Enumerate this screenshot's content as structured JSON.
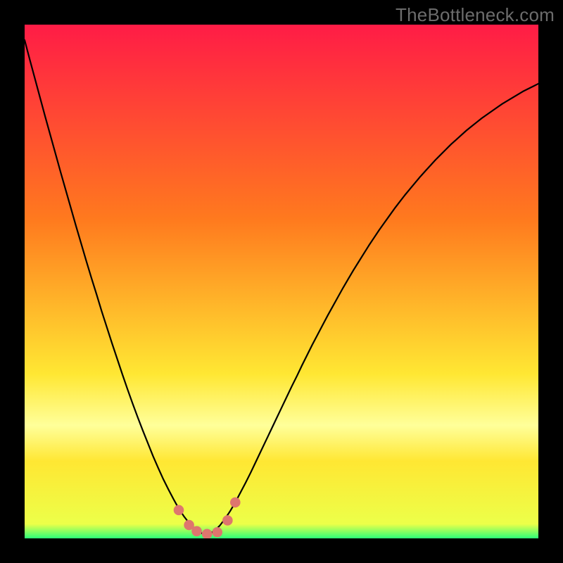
{
  "watermark": "TheBottleneck.com",
  "colors": {
    "frame": "#000000",
    "grad_top": "#ff1c46",
    "grad_mid1": "#ff7a1e",
    "grad_mid2": "#ffe733",
    "grad_band": "#ffff9a",
    "grad_bottom": "#2cff78",
    "curve": "#000000",
    "marker": "#de766e"
  },
  "chart_data": {
    "type": "line",
    "title": "",
    "xlabel": "",
    "ylabel": "",
    "xlim": [
      0,
      100
    ],
    "ylim": [
      0,
      100
    ],
    "x": [
      0,
      1,
      2,
      3,
      4,
      5,
      6,
      7,
      8,
      9,
      10,
      11,
      12,
      13,
      14,
      15,
      16,
      17,
      18,
      19,
      20,
      21,
      22,
      23,
      24,
      25,
      26,
      27,
      28,
      29,
      30,
      31,
      32,
      33,
      34,
      35,
      36,
      37,
      38,
      39,
      40,
      41,
      42,
      43,
      44,
      45,
      46,
      47,
      48,
      49,
      50,
      51,
      52,
      53,
      54,
      55,
      56,
      57,
      58,
      59,
      60,
      61,
      62,
      63,
      64,
      65,
      66,
      67,
      68,
      69,
      70,
      71,
      72,
      73,
      74,
      75,
      76,
      77,
      78,
      79,
      80,
      81,
      82,
      83,
      84,
      85,
      86,
      87,
      88,
      89,
      90,
      91,
      92,
      93,
      94,
      95,
      96,
      97,
      98,
      99,
      100
    ],
    "values": [
      97.0,
      93.2,
      89.5,
      85.8,
      82.1,
      78.5,
      74.9,
      71.3,
      67.8,
      64.3,
      60.8,
      57.4,
      54.0,
      50.7,
      47.5,
      44.2,
      41.1,
      38.0,
      35.0,
      32.0,
      29.1,
      26.3,
      23.6,
      21.0,
      18.5,
      16.0,
      13.7,
      11.5,
      9.5,
      7.6,
      5.8,
      4.3,
      3.0,
      2.0,
      1.2,
      0.8,
      0.9,
      1.5,
      2.5,
      3.8,
      5.3,
      7.0,
      8.9,
      10.8,
      12.8,
      14.9,
      17.0,
      19.1,
      21.2,
      23.3,
      25.4,
      27.5,
      29.6,
      31.6,
      33.7,
      35.7,
      37.7,
      39.6,
      41.5,
      43.4,
      45.2,
      47.0,
      48.8,
      50.5,
      52.2,
      53.8,
      55.4,
      57.0,
      58.5,
      60.0,
      61.4,
      62.8,
      64.2,
      65.5,
      66.8,
      68.0,
      69.2,
      70.4,
      71.5,
      72.6,
      73.7,
      74.7,
      75.7,
      76.7,
      77.6,
      78.5,
      79.4,
      80.2,
      81.0,
      81.8,
      82.5,
      83.2,
      83.9,
      84.6,
      85.2,
      85.8,
      86.4,
      87.0,
      87.5,
      88.0,
      88.5
    ],
    "markers_x": [
      30.0,
      32.0,
      33.5,
      35.5,
      37.5,
      39.5,
      41.0
    ],
    "markers_y": [
      5.5,
      2.6,
      1.4,
      0.85,
      1.2,
      3.5,
      7.0
    ],
    "marker_radius": 1.0,
    "pale_band_y_range": [
      70,
      84
    ],
    "green_strip_y_range": [
      0,
      2.5
    ]
  }
}
